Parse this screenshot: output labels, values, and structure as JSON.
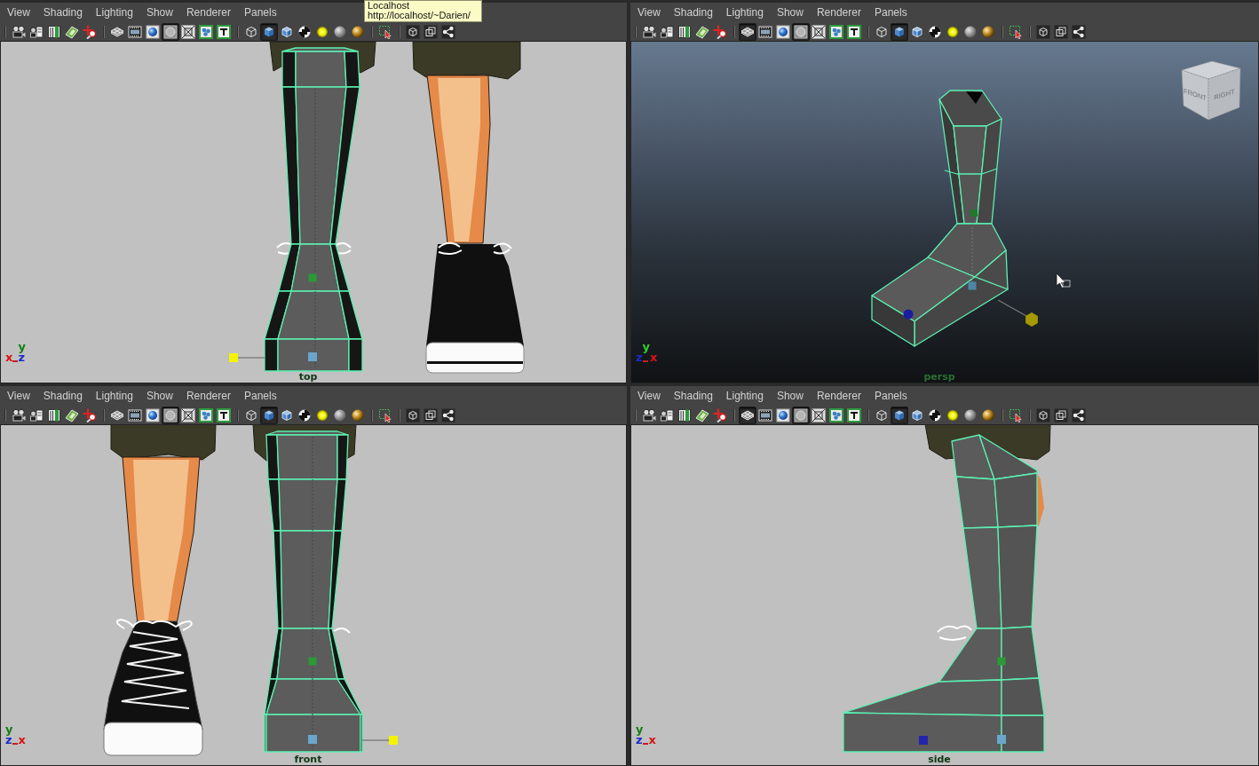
{
  "tooltip": {
    "lines": [
      "Localhost",
      "http://localhost/~Darien/"
    ]
  },
  "panels": [
    {
      "kind": "top",
      "menu": [
        "View",
        "Shading",
        "Lighting",
        "Show",
        "Renderer",
        "Panels"
      ],
      "toolbar": [
        [
          {
            "selected": false
          },
          {
            "selected": false
          },
          {
            "selected": false
          },
          {
            "selected": false
          },
          {
            "selected": false
          }
        ],
        [
          {
            "selected": false
          },
          {
            "selected": false
          },
          {
            "selected": false
          },
          {
            "selected": true
          },
          {
            "selected": false
          },
          {
            "selected": false
          },
          {
            "selected": false
          }
        ],
        [
          {
            "selected": false
          },
          {
            "selected": true
          },
          {
            "selected": false
          },
          {
            "selected": false
          },
          {
            "selected": false
          },
          {
            "selected": false
          },
          {
            "selected": false
          }
        ],
        [
          {
            "selected": false
          }
        ],
        [
          {
            "selected": false
          },
          {
            "selected": false
          },
          {
            "selected": false
          }
        ]
      ],
      "axis_up": {
        "label": "y",
        "color": "#137d13"
      },
      "axis_row": [
        {
          "label": "x",
          "color": "#dd1111"
        },
        {
          "label": "z",
          "color": "#1a2ccc"
        }
      ],
      "camera": "top"
    },
    {
      "kind": "perspective",
      "menu": [
        "View",
        "Shading",
        "Lighting",
        "Show",
        "Renderer",
        "Panels"
      ],
      "toolbar": [
        [
          {
            "selected": false
          },
          {
            "selected": false
          },
          {
            "selected": false
          },
          {
            "selected": false
          },
          {
            "selected": false
          }
        ],
        [
          {
            "selected": true
          },
          {
            "selected": false
          },
          {
            "selected": false
          },
          {
            "selected": true
          },
          {
            "selected": false
          },
          {
            "selected": false
          },
          {
            "selected": false
          }
        ],
        [
          {
            "selected": false
          },
          {
            "selected": true
          },
          {
            "selected": false
          },
          {
            "selected": false
          },
          {
            "selected": false
          },
          {
            "selected": false
          },
          {
            "selected": false
          }
        ],
        [
          {
            "selected": false
          }
        ],
        [
          {
            "selected": false
          },
          {
            "selected": false
          },
          {
            "selected": false
          }
        ]
      ],
      "view_cube": {
        "faces": [
          "FRONT",
          "RIGHT"
        ]
      },
      "axis_up": {
        "label": "y",
        "color": "#33cc33"
      },
      "axis_row": [
        {
          "label": "z",
          "color": "#1a2ccc"
        },
        {
          "label": "x",
          "color": "#dd1111"
        }
      ],
      "camera": "persp"
    },
    {
      "kind": "front",
      "menu": [
        "View",
        "Shading",
        "Lighting",
        "Show",
        "Renderer",
        "Panels"
      ],
      "toolbar": [
        [
          {
            "selected": false
          },
          {
            "selected": false
          },
          {
            "selected": false
          },
          {
            "selected": false
          },
          {
            "selected": false
          }
        ],
        [
          {
            "selected": false
          },
          {
            "selected": false
          },
          {
            "selected": false
          },
          {
            "selected": true
          },
          {
            "selected": false
          },
          {
            "selected": false
          },
          {
            "selected": false
          }
        ],
        [
          {
            "selected": false
          },
          {
            "selected": true
          },
          {
            "selected": false
          },
          {
            "selected": false
          },
          {
            "selected": false
          },
          {
            "selected": false
          },
          {
            "selected": false
          }
        ],
        [
          {
            "selected": false
          }
        ],
        [
          {
            "selected": false
          },
          {
            "selected": false
          },
          {
            "selected": false
          }
        ]
      ],
      "axis_up": {
        "label": "y",
        "color": "#137d13"
      },
      "axis_row": [
        {
          "label": "z",
          "color": "#1a2ccc"
        },
        {
          "label": "x",
          "color": "#dd1111"
        }
      ],
      "camera": "front"
    },
    {
      "kind": "side",
      "menu": [
        "View",
        "Shading",
        "Lighting",
        "Show",
        "Renderer",
        "Panels"
      ],
      "toolbar": [
        [
          {
            "selected": false
          },
          {
            "selected": false
          },
          {
            "selected": false
          },
          {
            "selected": false
          },
          {
            "selected": false
          }
        ],
        [
          {
            "selected": true
          },
          {
            "selected": false
          },
          {
            "selected": false
          },
          {
            "selected": true
          },
          {
            "selected": false
          },
          {
            "selected": false
          },
          {
            "selected": false
          }
        ],
        [
          {
            "selected": false
          },
          {
            "selected": true
          },
          {
            "selected": false
          },
          {
            "selected": false
          },
          {
            "selected": false
          },
          {
            "selected": false
          },
          {
            "selected": false
          }
        ],
        [
          {
            "selected": false
          }
        ],
        [
          {
            "selected": false
          },
          {
            "selected": false
          },
          {
            "selected": false
          }
        ]
      ],
      "axis_up": {
        "label": "y",
        "color": "#137d13"
      },
      "axis_row": [
        {
          "label": "z",
          "color": "#1a2ccc"
        },
        {
          "label": "x",
          "color": "#dd1111"
        }
      ],
      "camera": "side"
    }
  ]
}
